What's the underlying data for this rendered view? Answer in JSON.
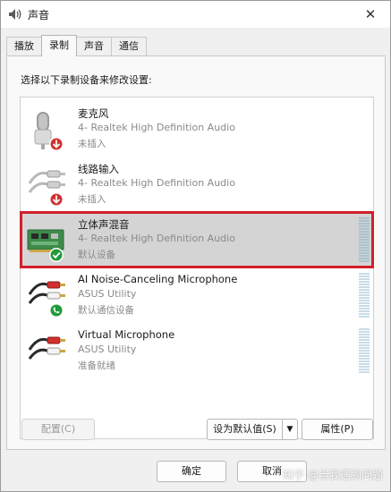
{
  "window": {
    "title": "声音",
    "close_symbol": "✕"
  },
  "tabs": [
    {
      "label": "播放",
      "active": false
    },
    {
      "label": "录制",
      "active": true
    },
    {
      "label": "声音",
      "active": false
    },
    {
      "label": "通信",
      "active": false
    }
  ],
  "instruction": "选择以下录制设备来修改设置:",
  "devices": [
    {
      "name": "麦克风",
      "description": "4- Realtek High Definition Audio",
      "status": "未插入",
      "icon": "microphone-icon",
      "badge": "unplugged-badge-icon"
    },
    {
      "name": "线路输入",
      "description": "4- Realtek High Definition Audio",
      "status": "未插入",
      "icon": "line-in-jack-icon",
      "badge": "unplugged-badge-icon"
    },
    {
      "name": "立体声混音",
      "description": "4- Realtek High Definition Audio",
      "status": "默认设备",
      "icon": "sound-card-icon",
      "badge": "default-check-badge-icon",
      "selected": true
    },
    {
      "name": "AI Noise-Canceling Microphone",
      "description": "ASUS Utility",
      "status": "默认通信设备",
      "icon": "line-in-jack-icon",
      "badge": "communication-phone-badge-icon"
    },
    {
      "name": "Virtual Microphone",
      "description": "ASUS Utility",
      "status": "准备就绪",
      "icon": "line-in-jack-icon",
      "badge": ""
    }
  ],
  "buttons": {
    "configure": "配置(C)",
    "set_default": "设为默认值(S)",
    "set_default_arrow": "▼",
    "properties": "属性(P)",
    "ok": "确定",
    "cancel": "取消"
  },
  "watermark": "知乎 @当我遇到问题",
  "colors": {
    "selection_outline": "#d0202a",
    "selected_background": "#d4d4d4",
    "check_badge": "#1f9b3a",
    "unplugged_badge": "#d32f2f"
  }
}
